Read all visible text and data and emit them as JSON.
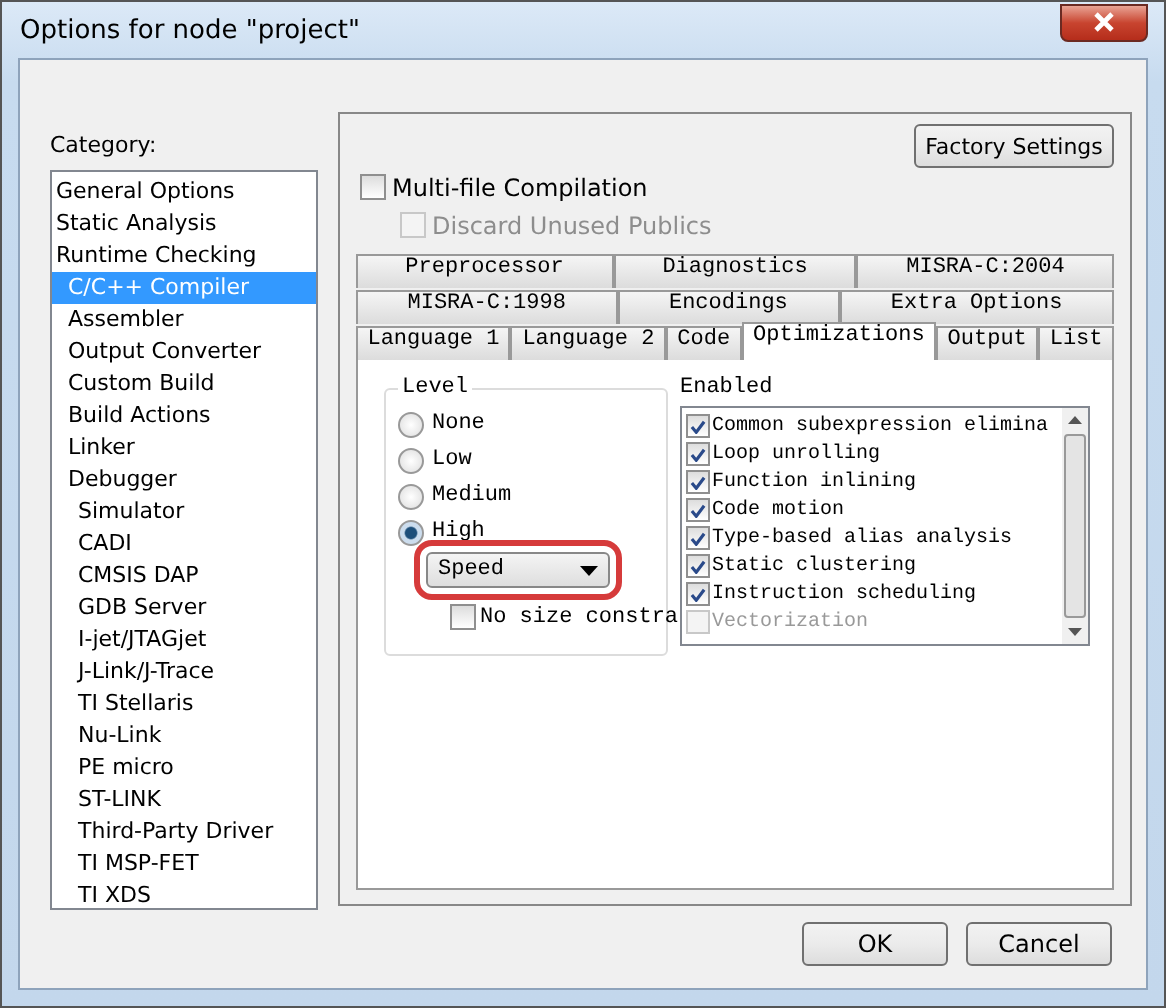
{
  "window": {
    "title": "Options for node \"project\""
  },
  "category": {
    "label": "Category:",
    "items": [
      {
        "label": "General Options",
        "selected": false,
        "indented": false
      },
      {
        "label": "Static Analysis",
        "selected": false,
        "indented": false
      },
      {
        "label": "Runtime Checking",
        "selected": false,
        "indented": false
      },
      {
        "label": "C/C++ Compiler",
        "selected": true,
        "indented": true
      },
      {
        "label": "Assembler",
        "selected": false,
        "indented": true
      },
      {
        "label": "Output Converter",
        "selected": false,
        "indented": true
      },
      {
        "label": "Custom Build",
        "selected": false,
        "indented": true
      },
      {
        "label": "Build Actions",
        "selected": false,
        "indented": true
      },
      {
        "label": "Linker",
        "selected": false,
        "indented": true
      },
      {
        "label": "Debugger",
        "selected": false,
        "indented": true,
        "children": [
          {
            "label": "Simulator",
            "selected": false
          },
          {
            "label": "CADI",
            "selected": false
          },
          {
            "label": "CMSIS DAP",
            "selected": false
          },
          {
            "label": "GDB Server",
            "selected": false
          },
          {
            "label": "I-jet/JTAGjet",
            "selected": false
          },
          {
            "label": "J-Link/J-Trace",
            "selected": false
          },
          {
            "label": "TI Stellaris",
            "selected": false
          },
          {
            "label": "Nu-Link",
            "selected": false
          },
          {
            "label": "PE micro",
            "selected": false
          },
          {
            "label": "ST-LINK",
            "selected": false
          },
          {
            "label": "Third-Party Driver",
            "selected": false
          },
          {
            "label": "TI MSP-FET",
            "selected": false
          },
          {
            "label": "TI XDS",
            "selected": false
          }
        ]
      }
    ]
  },
  "factory_settings_button": "Factory Settings",
  "options": [
    {
      "label": "Multi-file Compilation",
      "checked": false,
      "disabled": false
    },
    {
      "label": "Discard Unused Publics",
      "checked": false,
      "disabled": true
    }
  ],
  "tab_rows": [
    [
      {
        "label": "Preprocessor",
        "selected": false
      },
      {
        "label": "Diagnostics",
        "selected": false
      },
      {
        "label": "MISRA-C:2004",
        "selected": false
      }
    ],
    [
      {
        "label": "MISRA-C:1998",
        "selected": false
      },
      {
        "label": "Encodings",
        "selected": false
      },
      {
        "label": "Extra Options",
        "selected": false
      }
    ],
    [
      {
        "label": "Language 1",
        "selected": false
      },
      {
        "label": "Language 2",
        "selected": false
      },
      {
        "label": "Code",
        "selected": false
      },
      {
        "label": "Optimizations",
        "selected": true
      },
      {
        "label": "Output",
        "selected": false
      },
      {
        "label": "List",
        "selected": false
      }
    ]
  ],
  "level": {
    "title": "Level",
    "options": [
      {
        "label": "None",
        "selected": false
      },
      {
        "label": "Low",
        "selected": false
      },
      {
        "label": "Medium",
        "selected": false
      },
      {
        "label": "High",
        "selected": true
      }
    ],
    "goal_dropdown": "Speed",
    "no_size_constraints": {
      "label": "No size constra",
      "checked": false
    }
  },
  "enabled": {
    "title": "Enabled",
    "items": [
      {
        "label": "Common subexpression elimina",
        "checked": true,
        "disabled": false
      },
      {
        "label": "Loop unrolling",
        "checked": true,
        "disabled": false
      },
      {
        "label": "Function inlining",
        "checked": true,
        "disabled": false
      },
      {
        "label": "Code motion",
        "checked": true,
        "disabled": false
      },
      {
        "label": "Type-based alias analysis",
        "checked": true,
        "disabled": false
      },
      {
        "label": "Static clustering",
        "checked": true,
        "disabled": false
      },
      {
        "label": "Instruction scheduling",
        "checked": true,
        "disabled": false
      },
      {
        "label": "Vectorization",
        "checked": false,
        "disabled": true
      }
    ]
  },
  "buttons": [
    "OK",
    "Cancel"
  ]
}
